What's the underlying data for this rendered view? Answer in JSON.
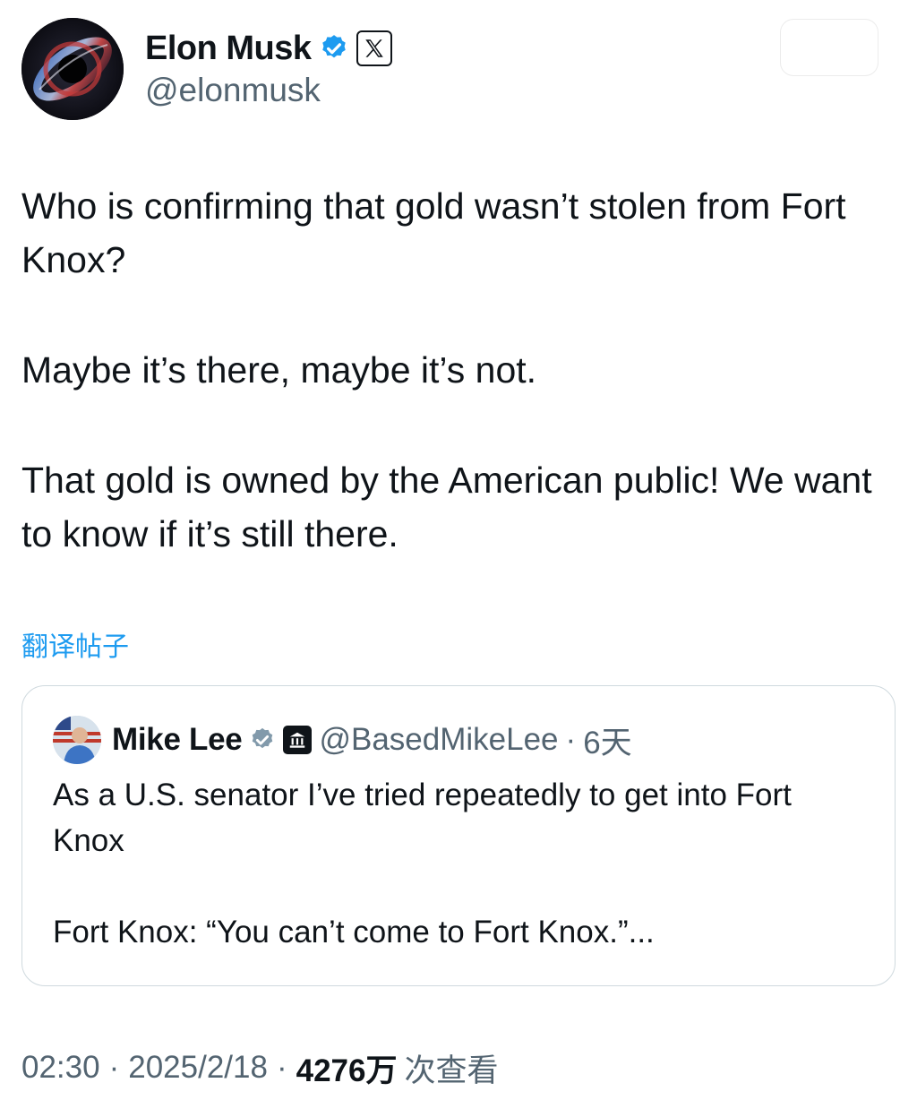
{
  "author": {
    "display_name": "Elon Musk",
    "handle": "@elonmusk",
    "verified_badge_color": "#1d9bf0",
    "affiliate_badge_icon": "x-logo-icon",
    "avatar_icon": "black-hole-avatar"
  },
  "tweet": {
    "paragraphs": [
      "Who is confirming that gold wasn’t stolen from Fort Knox?",
      "Maybe it’s there, maybe it’s not.",
      "That gold is owned by the American public! We want to know if it’s still there."
    ],
    "translate_label": "翻译帖子"
  },
  "quoted_tweet": {
    "display_name": "Mike Lee",
    "handle": "@BasedMikeLee",
    "separator": "·",
    "time": "6天",
    "affiliate_badge_icon": "government-building-icon",
    "paragraphs": [
      "As a U.S. senator I’ve tried repeatedly to get into Fort Knox",
      "Fort Knox: “You can’t come to Fort Knox.”..."
    ]
  },
  "meta": {
    "time": "02:30",
    "separator": "·",
    "date": "2025/2/18",
    "views_count": "4276万",
    "views_label": "次查看"
  },
  "colors": {
    "link": "#1d9bf0",
    "text": "#0f1419",
    "secondary_text": "#536471",
    "border": "#cfd9de"
  }
}
